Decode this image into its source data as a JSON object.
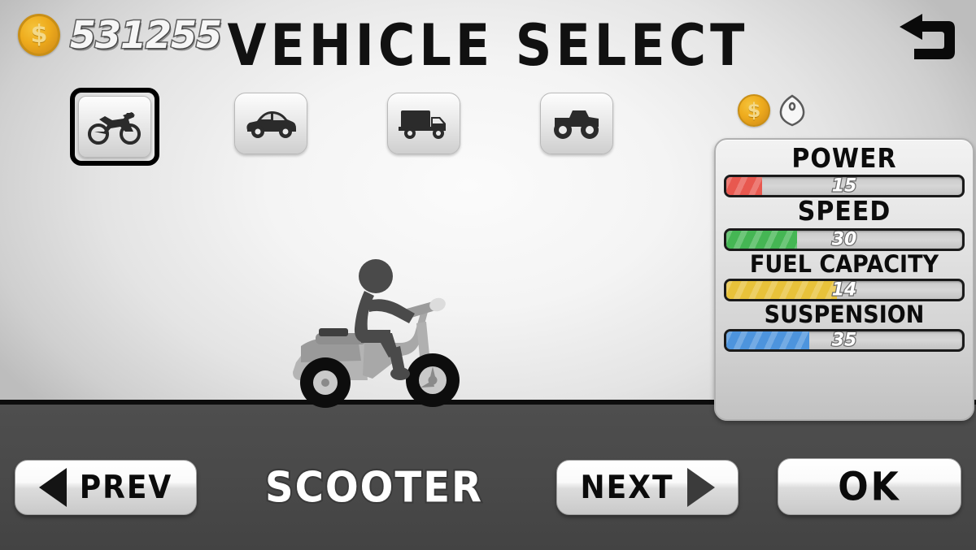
{
  "header": {
    "title": "VEHICLE SELECT",
    "coin_icon": "coin-icon",
    "coin_amount": "531255",
    "back_icon": "back-arrow-icon"
  },
  "vehicle_tabs": [
    {
      "id": "motorcycle",
      "icon": "motorcycle-icon",
      "selected": true
    },
    {
      "id": "car",
      "icon": "car-icon",
      "selected": false
    },
    {
      "id": "truck",
      "icon": "truck-icon",
      "selected": false
    },
    {
      "id": "monster-truck",
      "icon": "monster-truck-icon",
      "selected": false
    }
  ],
  "panel_currency": {
    "coin_icon": "coin-icon",
    "gem_icon": "gem-icon"
  },
  "stats": [
    {
      "label": "POWER",
      "value": "15",
      "percent": 15,
      "color": "#e8584f"
    },
    {
      "label": "SPEED",
      "value": "30",
      "percent": 30,
      "color": "#45b654"
    },
    {
      "label": "FUEL CAPACITY",
      "value": "14",
      "percent": 47,
      "color": "#e8c23a"
    },
    {
      "label": "SUSPENSION",
      "value": "35",
      "percent": 35,
      "color": "#4d94dd"
    }
  ],
  "preview": {
    "vehicle_name": "SCOOTER",
    "sprite": "scooter-with-stickman-rider"
  },
  "footer": {
    "prev_label": "PREV",
    "next_label": "NEXT",
    "ok_label": "OK",
    "prev_icon": "triangle-left-icon",
    "next_icon": "triangle-right-icon"
  },
  "colors": {
    "coin_gold": "#eeab1c",
    "ground": "#4a4a4a",
    "power_bar": "#e8584f",
    "speed_bar": "#45b654",
    "fuel_bar": "#e8c23a",
    "suspension_bar": "#4d94dd"
  }
}
